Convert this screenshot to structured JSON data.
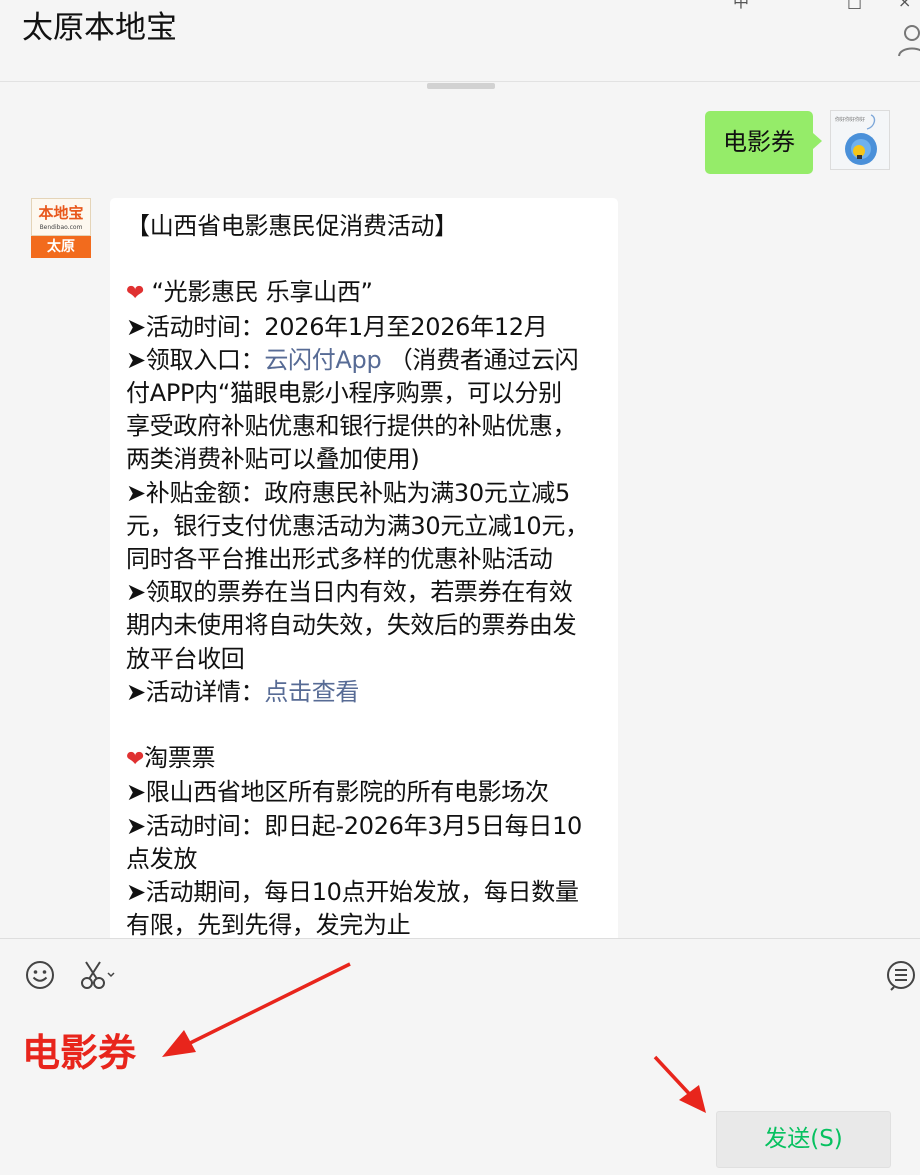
{
  "header": {
    "title": "太原本地宝",
    "top_fragments": [
      "中",
      "□",
      "×"
    ]
  },
  "messages": {
    "sent": {
      "text": "电影券"
    },
    "received": {
      "lines": [
        "【山西省电影惠民促消费活动】",
        "",
        "“光影惠民 乐享山西”",
        "➤活动时间：2026年1月至2026年12月",
        "➤领取入口：",
        "付APP内“猫眼电影小程序购票，可以分别",
        "享受政府补贴优惠和银行提供的补贴优惠，",
        "两类消费补贴可以叠加使用)",
        "➤补贴金额：政府惠民补贴为满30元立减5",
        "元，银行支付优惠活动为满30元立减10元，",
        "同时各平台推出形式多样的优惠补贴活动",
        "➤领取的票券在当日内有效，若票券在有效",
        "期内未使用将自动失效，失效后的票券由发",
        "放平台收回",
        "➤活动详情：",
        "",
        "淘票票",
        "➤限山西省地区所有影院的所有电影场次",
        "➤活动时间：即日起-2026年3月5日每日10",
        "点发放",
        "➤活动期间，每日10点开始发放，每日数量",
        "有限，先到先得，发完为止"
      ],
      "link_app": "云闪付App",
      "link_app_suffix": " （消费者通过云闪",
      "link_details": "点击查看",
      "heart_glyph": "❤"
    }
  },
  "bot_avatar": {
    "logo_main": "本地宝",
    "logo_sub": "Bendibao.com",
    "logo_city": "太原"
  },
  "input": {
    "typed_text": "电影券",
    "send_label": "发送(S)"
  },
  "colors": {
    "sent_bubble": "#95ec69",
    "link": "#576b95",
    "annotation_red": "#e8251c",
    "send_text": "#07c160"
  }
}
